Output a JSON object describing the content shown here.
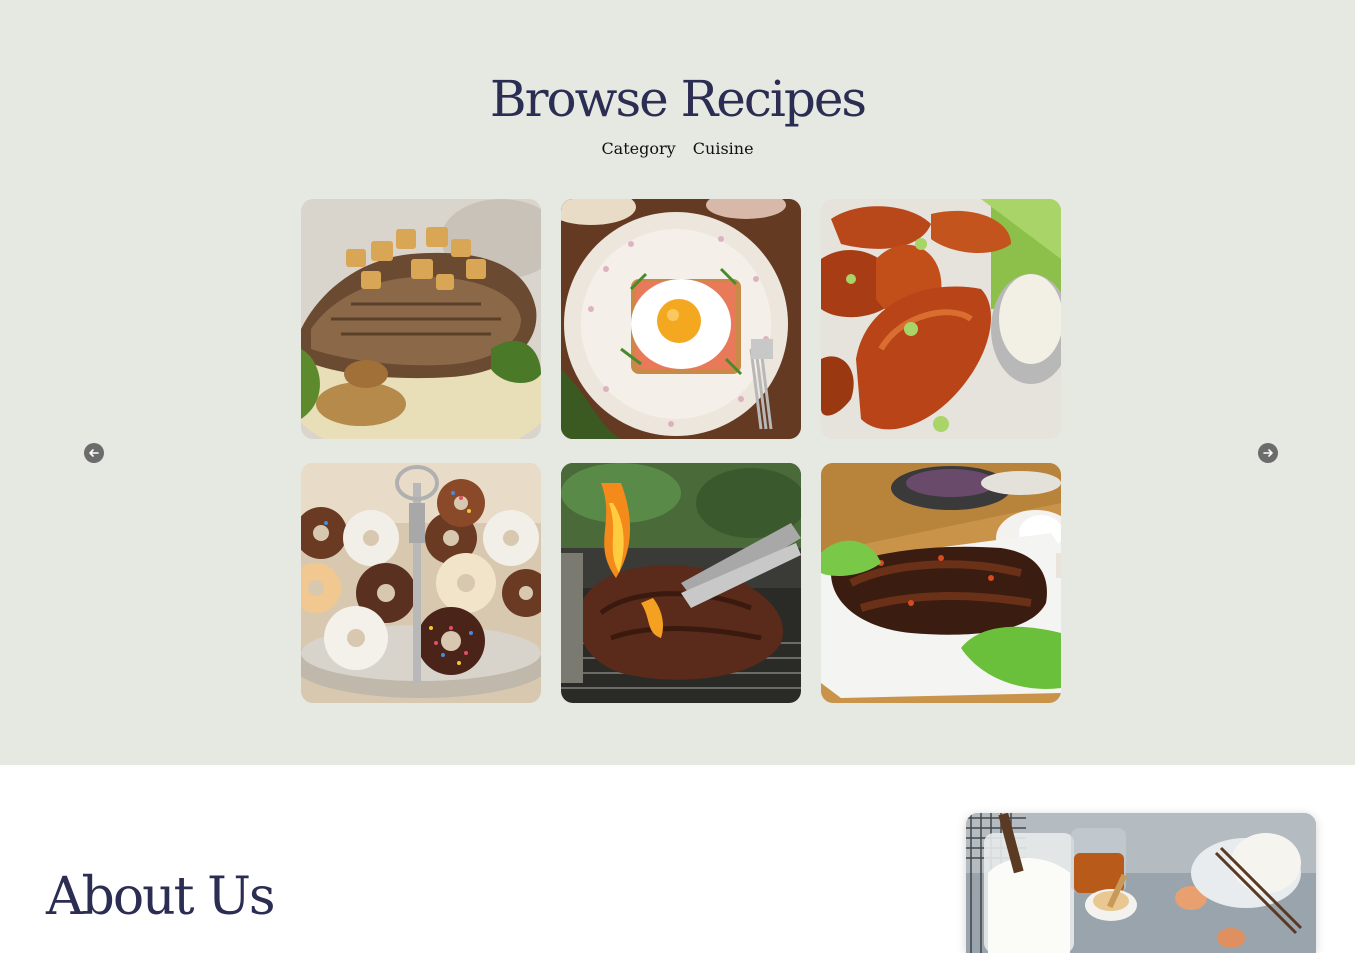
{
  "browse": {
    "title": "Browse Recipes",
    "filters": [
      "Category",
      "Cuisine"
    ]
  },
  "carousel": {
    "prev_icon": "arrow-left-icon",
    "next_icon": "arrow-right-icon",
    "recipes": [
      {
        "image": "grilled-pork-chop-with-apples"
      },
      {
        "image": "fried-egg-toast-on-plate"
      },
      {
        "image": "glazed-chicken-wings-with-dip"
      },
      {
        "image": "donuts-on-tiered-stand"
      },
      {
        "image": "steak-on-flaming-grill"
      },
      {
        "image": "glazed-lamb-ribs-platter"
      }
    ]
  },
  "about": {
    "title": "About Us",
    "image": "baking-ingredients-flour-honey-eggs"
  },
  "colors": {
    "browse_bg": "#e6e8e2",
    "heading": "#2b2d52",
    "arrow": "#6c6c6c"
  }
}
